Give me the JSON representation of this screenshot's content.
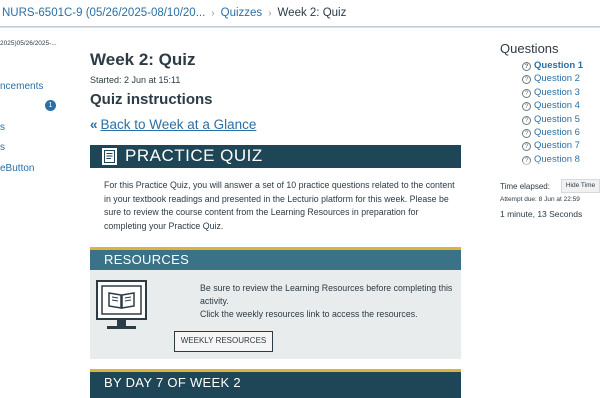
{
  "breadcrumb": {
    "course": "NURS-6501C-9 (05/26/2025-08/10/20...",
    "quizzes": "Quizzes",
    "current": "Week 2: Quiz"
  },
  "sidebar": {
    "course_label": "2025)05/26/2025-...",
    "items": [
      {
        "label": "ncements"
      },
      {
        "label": "s"
      },
      {
        "label": "s"
      },
      {
        "label": "eButton"
      }
    ],
    "badge_count": "1"
  },
  "main": {
    "title": "Week 2: Quiz",
    "started": "Started: 2 Jun at 15:11",
    "instructions_title": "Quiz instructions",
    "back_link": "Back to Week at a Glance",
    "practice_quiz": {
      "heading": "PRACTICE QUIZ",
      "icon": "document-icon",
      "body": "For this Practice Quiz, you will answer a set of 10 practice questions related to the content in your textbook readings and presented in the Lecturio platform for this week. Please be sure to review the course content from the Learning Resources in preparation for completing your Practice Quiz."
    },
    "resources": {
      "heading": "RESOURCES",
      "icon": "book-monitor-icon",
      "line1": "Be sure to review the Learning Resources before completing this activity.",
      "line2": "Click the weekly resources link to access the resources.",
      "button_label": "WEEKLY RESOURCES"
    },
    "day7": {
      "heading": "BY DAY 7 OF WEEK 2"
    }
  },
  "questions_panel": {
    "title": "Questions",
    "items": [
      {
        "label": "Question 1",
        "active": true
      },
      {
        "label": "Question 2"
      },
      {
        "label": "Question 3"
      },
      {
        "label": "Question 4"
      },
      {
        "label": "Question 5"
      },
      {
        "label": "Question 6"
      },
      {
        "label": "Question 7"
      },
      {
        "label": "Question 8"
      }
    ],
    "time_label": "Time elapsed:",
    "hide_time_label": "Hide Time",
    "attempt_due": "Attempt due: 8 Jun at 22:59",
    "elapsed_value": "1 minute, 13 Seconds"
  },
  "colors": {
    "link": "#2b6fa5",
    "dark_banner": "#1f4656",
    "resources_banner": "#3a7287",
    "gold_accent": "#e0b23b",
    "text": "#2d3b45"
  }
}
